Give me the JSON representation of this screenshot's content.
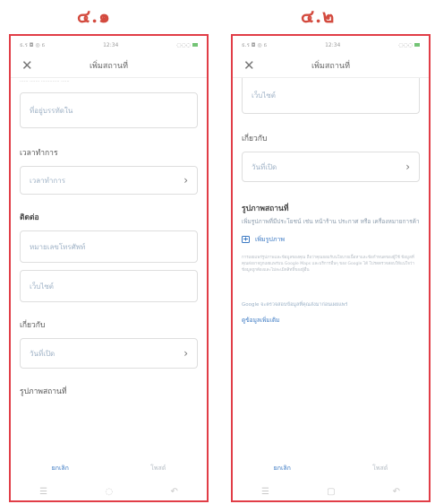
{
  "panels": [
    {
      "number": "๔.๑"
    },
    {
      "number": "๔.๒"
    }
  ],
  "status_bar": {
    "left": "ธ.ร ◘ ◎ ธ",
    "time": "12:34",
    "right": "◌◌◌"
  },
  "header": {
    "title": "เพิ่มสถานที่"
  },
  "panel1": {
    "top_peek": "...... .......              ............. ......",
    "field_placeholder": "ที่อยู่บรรทัดใน",
    "opening_hours_label": "เวลาทำการ",
    "opening_hours_value": "เวลาทำการ",
    "contact_label": "ติดต่อ",
    "phone_placeholder": "หมายเลขโทรศัพท์",
    "website_placeholder": "เว็บไซต์",
    "about_label": "เกี่ยวกับ",
    "about_value": "วันที่เปิด",
    "photos_label": "รูปภาพสถานที่",
    "cancel_button": "ยกเลิก",
    "save_button": "โพสต์"
  },
  "panel2": {
    "website_value": "เว็บไซต์",
    "about_label": "เกี่ยวกับ",
    "about_value": "วันที่เปิด",
    "photos_label": "รูปภาพสถานที่",
    "photos_desc": "เพิ่มรูปภาพที่มีประโยชน์ เช่น หน้าร้าน ประกาศ หรือ เครื่องหมายการค้า",
    "add_photo": "เพิ่มรูปภาพ",
    "fine_print": "การเผยแพร่รูปภาพและข้อมูลของคุณ ถือว่าคุณยอมรับนโยบายเนื้อหาและข้อกำหนดของผู้ใช้ ข้อมูลที่คุณส่งอาจถูกเผยแพร่บน Google Maps และบริการอื่นๆ ของ Google ได้ โปรดตรวจสอบให้แน่ใจว่าข้อมูลถูกต้องและไม่ละเมิดสิทธิ์ของผู้อื่น",
    "google_note": "Google จะตรวจสอบข้อมูลที่คุณส่งมาก่อนเผยแพร่",
    "more_link": "ดูข้อมูลเพิ่มเติม",
    "cancel_button": "ยกเลิก",
    "save_button": "โพสต์"
  }
}
